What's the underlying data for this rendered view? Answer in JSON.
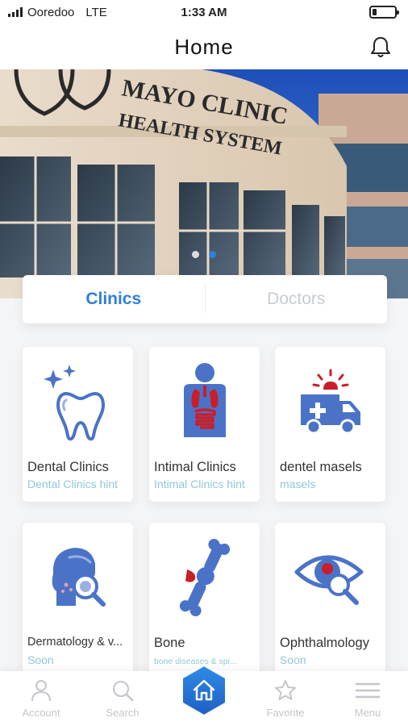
{
  "status_bar": {
    "carrier": "Ooredoo",
    "network": "LTE",
    "time": "1:33 AM",
    "battery_level": 0.2
  },
  "header": {
    "title": "Home",
    "bell_icon": "bell-icon"
  },
  "hero": {
    "sign_line1": "MAYO CLINIC",
    "sign_line2": "HEALTH SYSTEM",
    "slides": 2,
    "active_slide": 2
  },
  "tabs": [
    {
      "label": "Clinics",
      "active": true
    },
    {
      "label": "Doctors",
      "active": false
    }
  ],
  "clinics": [
    {
      "name": "Dental Clinics",
      "hint": "Dental Clinics hint",
      "icon": "tooth-icon"
    },
    {
      "name": "Intimal Clinics",
      "hint": "Intimal Clinics hint",
      "icon": "organs-icon"
    },
    {
      "name": "dentel masels",
      "hint": "masels",
      "icon": "ambulance-icon"
    },
    {
      "name": "Dermatology & v...",
      "hint": "Soon",
      "icon": "skin-magnifier-icon"
    },
    {
      "name": "Bone",
      "hint": "bone diseases & spi...",
      "icon": "bone-joint-icon"
    },
    {
      "name": "Ophthalmology",
      "hint": "Soon",
      "icon": "eye-icon"
    }
  ],
  "bottom_nav": [
    {
      "label": "Account",
      "icon": "person-icon"
    },
    {
      "label": "Search",
      "icon": "search-icon"
    },
    {
      "label": "",
      "icon": "home-icon"
    },
    {
      "label": "Favorite",
      "icon": "star-icon"
    },
    {
      "label": "Menu",
      "icon": "menu-icon"
    }
  ],
  "colors": {
    "accent": "#2f7fd6",
    "icon_blue": "#4a73c8",
    "hint": "#8fc9d6",
    "inactive": "#c8ccd2",
    "red": "#c81e2a"
  }
}
